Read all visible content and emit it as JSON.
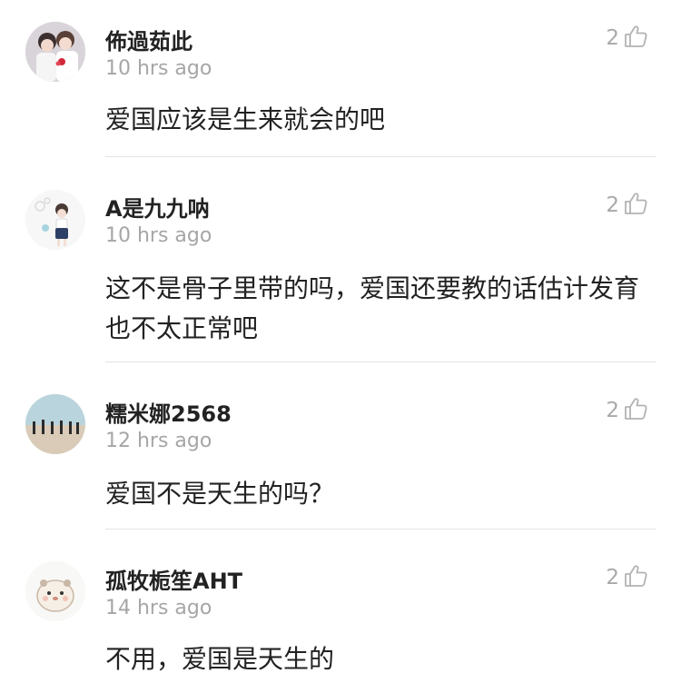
{
  "comments": [
    {
      "username": "佈過茹此",
      "time": "10 hrs ago",
      "likes": "2",
      "text": "爱国应该是生来就会的吧",
      "avatar": "couple-avatar"
    },
    {
      "username": "A是九九呐",
      "time": "10 hrs ago",
      "likes": "2",
      "text": "这不是骨子里带的吗，爱国还要教的话估计发育也不太正常吧",
      "avatar": "girl-illustration-avatar"
    },
    {
      "username": "糯米娜2568",
      "time": "12 hrs ago",
      "likes": "2",
      "text": "爱国不是天生的吗？",
      "avatar": "beach-group-avatar"
    },
    {
      "username": "孤牧栀笙AHT",
      "time": "14 hrs ago",
      "likes": "2",
      "text": "不用，爱国是天生的",
      "avatar": "hamster-avatar"
    }
  ],
  "colors": {
    "text": "#222222",
    "meta": "#a6a6a6",
    "divider": "#e3e3e3"
  }
}
